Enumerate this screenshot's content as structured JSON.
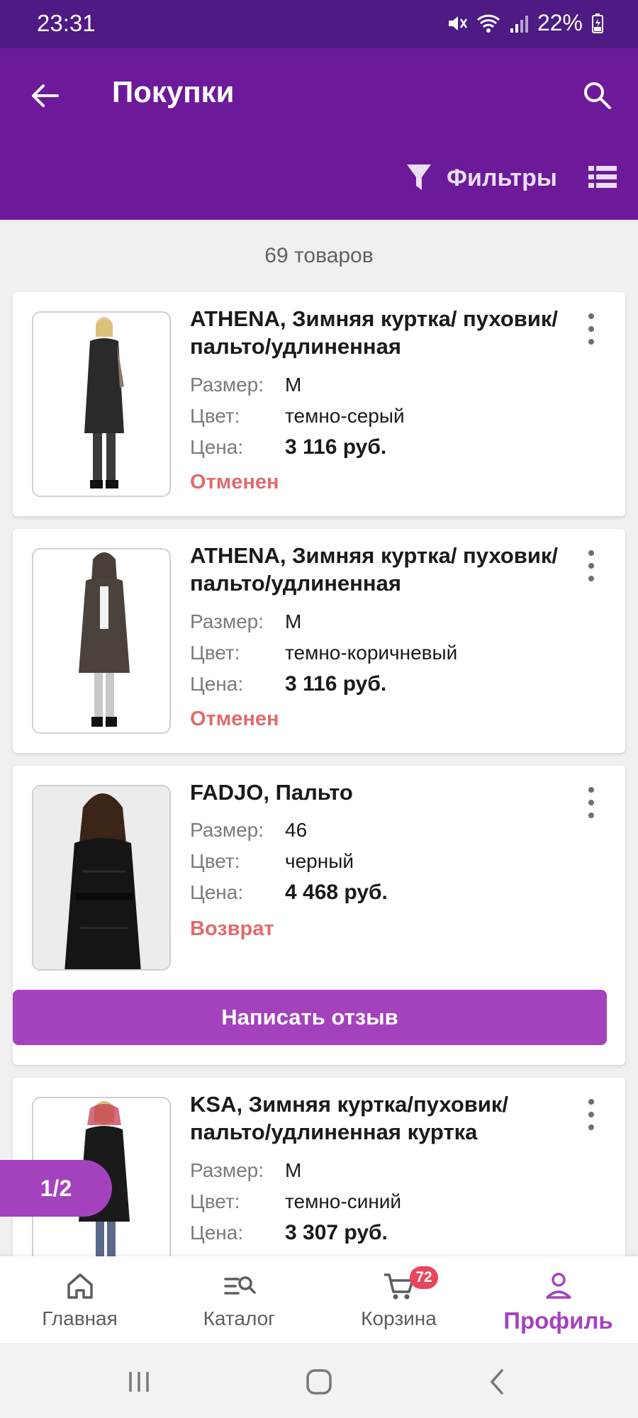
{
  "status_bar": {
    "time": "23:31",
    "battery": "22%"
  },
  "header": {
    "title": "Покупки",
    "filters_label": "Фильтры"
  },
  "list": {
    "count_text": "69 товаров"
  },
  "labels": {
    "size": "Размер:",
    "color": "Цвет:",
    "price": "Цена:"
  },
  "products": [
    {
      "title": "ATHENA, Зимняя куртка/ пуховик/пальто/удлиненная",
      "size": "M",
      "color": "темно-серый",
      "price": "3 116 руб.",
      "status": "Отменен"
    },
    {
      "title": "ATHENA, Зимняя куртка/ пуховик/пальто/удлиненная",
      "size": "M",
      "color": "темно-коричневый",
      "price": "3 116 руб.",
      "status": "Отменен"
    },
    {
      "title": "FADJO, Пальто",
      "size": "46",
      "color": "черный",
      "price": "4 468 руб.",
      "status": "Возврат",
      "review_button": "Написать отзыв"
    },
    {
      "title": "KSA, Зимняя куртка/пуховик/ пальто/удлиненная куртка",
      "size": "M",
      "color": "темно-синий",
      "price": "3 307 руб."
    }
  ],
  "pagination": {
    "label": "1/2"
  },
  "bottom_nav": {
    "items": [
      {
        "label": "Главная",
        "icon": "home-icon"
      },
      {
        "label": "Каталог",
        "icon": "catalog-search-icon"
      },
      {
        "label": "Корзина",
        "icon": "cart-icon",
        "badge": "72"
      },
      {
        "label": "Профиль",
        "icon": "profile-icon",
        "active": true
      }
    ]
  },
  "colors": {
    "status_bar": "#4e1a83",
    "app_bar": "#6c1a9a",
    "accent": "#a442bd",
    "status_red": "#e06b6b",
    "badge": "#e8465a"
  }
}
